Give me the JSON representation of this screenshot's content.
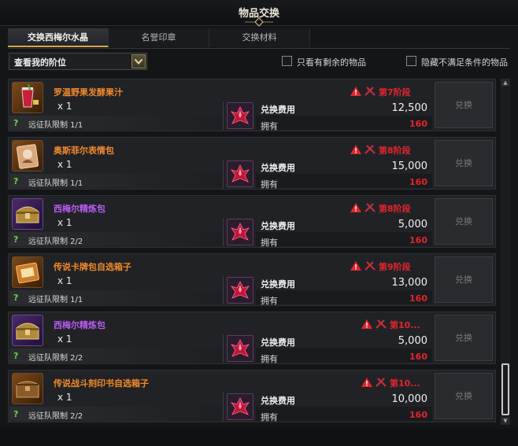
{
  "window": {
    "title": "物品交换"
  },
  "tabs": [
    {
      "label": "交换西梅尔水晶",
      "active": true
    },
    {
      "label": "名誉印章",
      "active": false
    },
    {
      "label": "交换材料",
      "active": false
    }
  ],
  "filter": {
    "dropdown_label": "查看我的阶位",
    "show_remaining": "只看有剩余的物品",
    "hide_unmet": "隐藏不满足条件的物品"
  },
  "labels": {
    "cost": "兑换费用",
    "owned": "拥有",
    "exchange_button": "兑换"
  },
  "colors": {
    "orange_name": "#f08a2a",
    "purple_name": "#b65cf0",
    "warning_red": "#e0262c",
    "accent_gold": "#d2a94a"
  },
  "items": [
    {
      "name": "罗温野果发酵果汁",
      "rarity": "orange",
      "icon": "juice-glass-icon",
      "qty": "x 1",
      "limit": "远征队限制 1/1",
      "tier": "第7阶段",
      "cost": "12,500",
      "owned": "160"
    },
    {
      "name": "奥斯菲尔表情包",
      "rarity": "orange",
      "icon": "emote-card-icon",
      "qty": "x 1",
      "limit": "远征队限制 1/1",
      "tier": "第8阶段",
      "cost": "15,000",
      "owned": "160"
    },
    {
      "name": "西梅尔精炼包",
      "rarity": "purple",
      "icon": "treasure-chest-icon",
      "qty": "x 1",
      "limit": "远征队限制 2/2",
      "tier": "第8阶段",
      "cost": "5,000",
      "owned": "160"
    },
    {
      "name": "传说卡牌包自选箱子",
      "rarity": "orange",
      "icon": "card-box-icon",
      "qty": "x 1",
      "limit": "远征队限制 1/1",
      "tier": "第9阶段",
      "cost": "13,000",
      "owned": "160"
    },
    {
      "name": "西梅尔精炼包",
      "rarity": "purple",
      "icon": "treasure-chest-icon",
      "qty": "x 1",
      "limit": "远征队限制 2/2",
      "tier": "第10...",
      "cost": "5,000",
      "owned": "160"
    },
    {
      "name": "传说战斗刻印书自选箱子",
      "rarity": "orange",
      "icon": "engraving-book-box-icon",
      "qty": "x 1",
      "limit": "远征队限制 2/2",
      "tier": "第10...",
      "cost": "10,000",
      "owned": "160"
    }
  ],
  "scroll": {
    "position_fraction": 1.0
  }
}
